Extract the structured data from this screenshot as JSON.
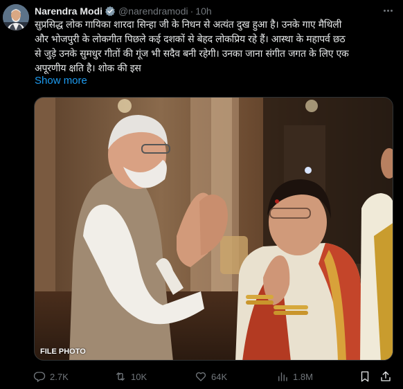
{
  "tweet": {
    "author_name": "Narendra Modi",
    "handle": "@narendramodi",
    "separator": "·",
    "time": "10h",
    "text_lines": [
      "सुप्रसिद्ध लोक गायिका शारदा सिन्हा जी के निधन से अत्यंत दुख हुआ है। उनके गाए मैथिली",
      "और भोजपुरी के लोकगीत पिछले कई दशकों से बेहद लोकप्रिय रहे हैं। आस्था के महापर्व छठ",
      "से जुड़े उनके सुमधुर गीतों की गूंज भी सदैव बनी रहेगी। उनका जाना संगीत जगत के लिए एक",
      "अपूरणीय क्षति है। शोक की इस"
    ],
    "show_more_label": "Show more",
    "media_caption": "FILE PHOTO"
  },
  "actions": {
    "reply_count": "2.7K",
    "retweet_count": "10K",
    "like_count": "64K",
    "views_count": "1.8M"
  },
  "icons": {
    "verified": "verified-badge-icon",
    "more": "more-options-icon",
    "reply": "reply-icon",
    "retweet": "retweet-icon",
    "like": "heart-icon",
    "views": "views-icon",
    "bookmark": "bookmark-icon",
    "share": "share-icon"
  },
  "colors": {
    "background": "#000000",
    "text_primary": "#e7e9ea",
    "text_secondary": "#71767b",
    "link": "#1d9bf0",
    "verified": "#829aab"
  }
}
